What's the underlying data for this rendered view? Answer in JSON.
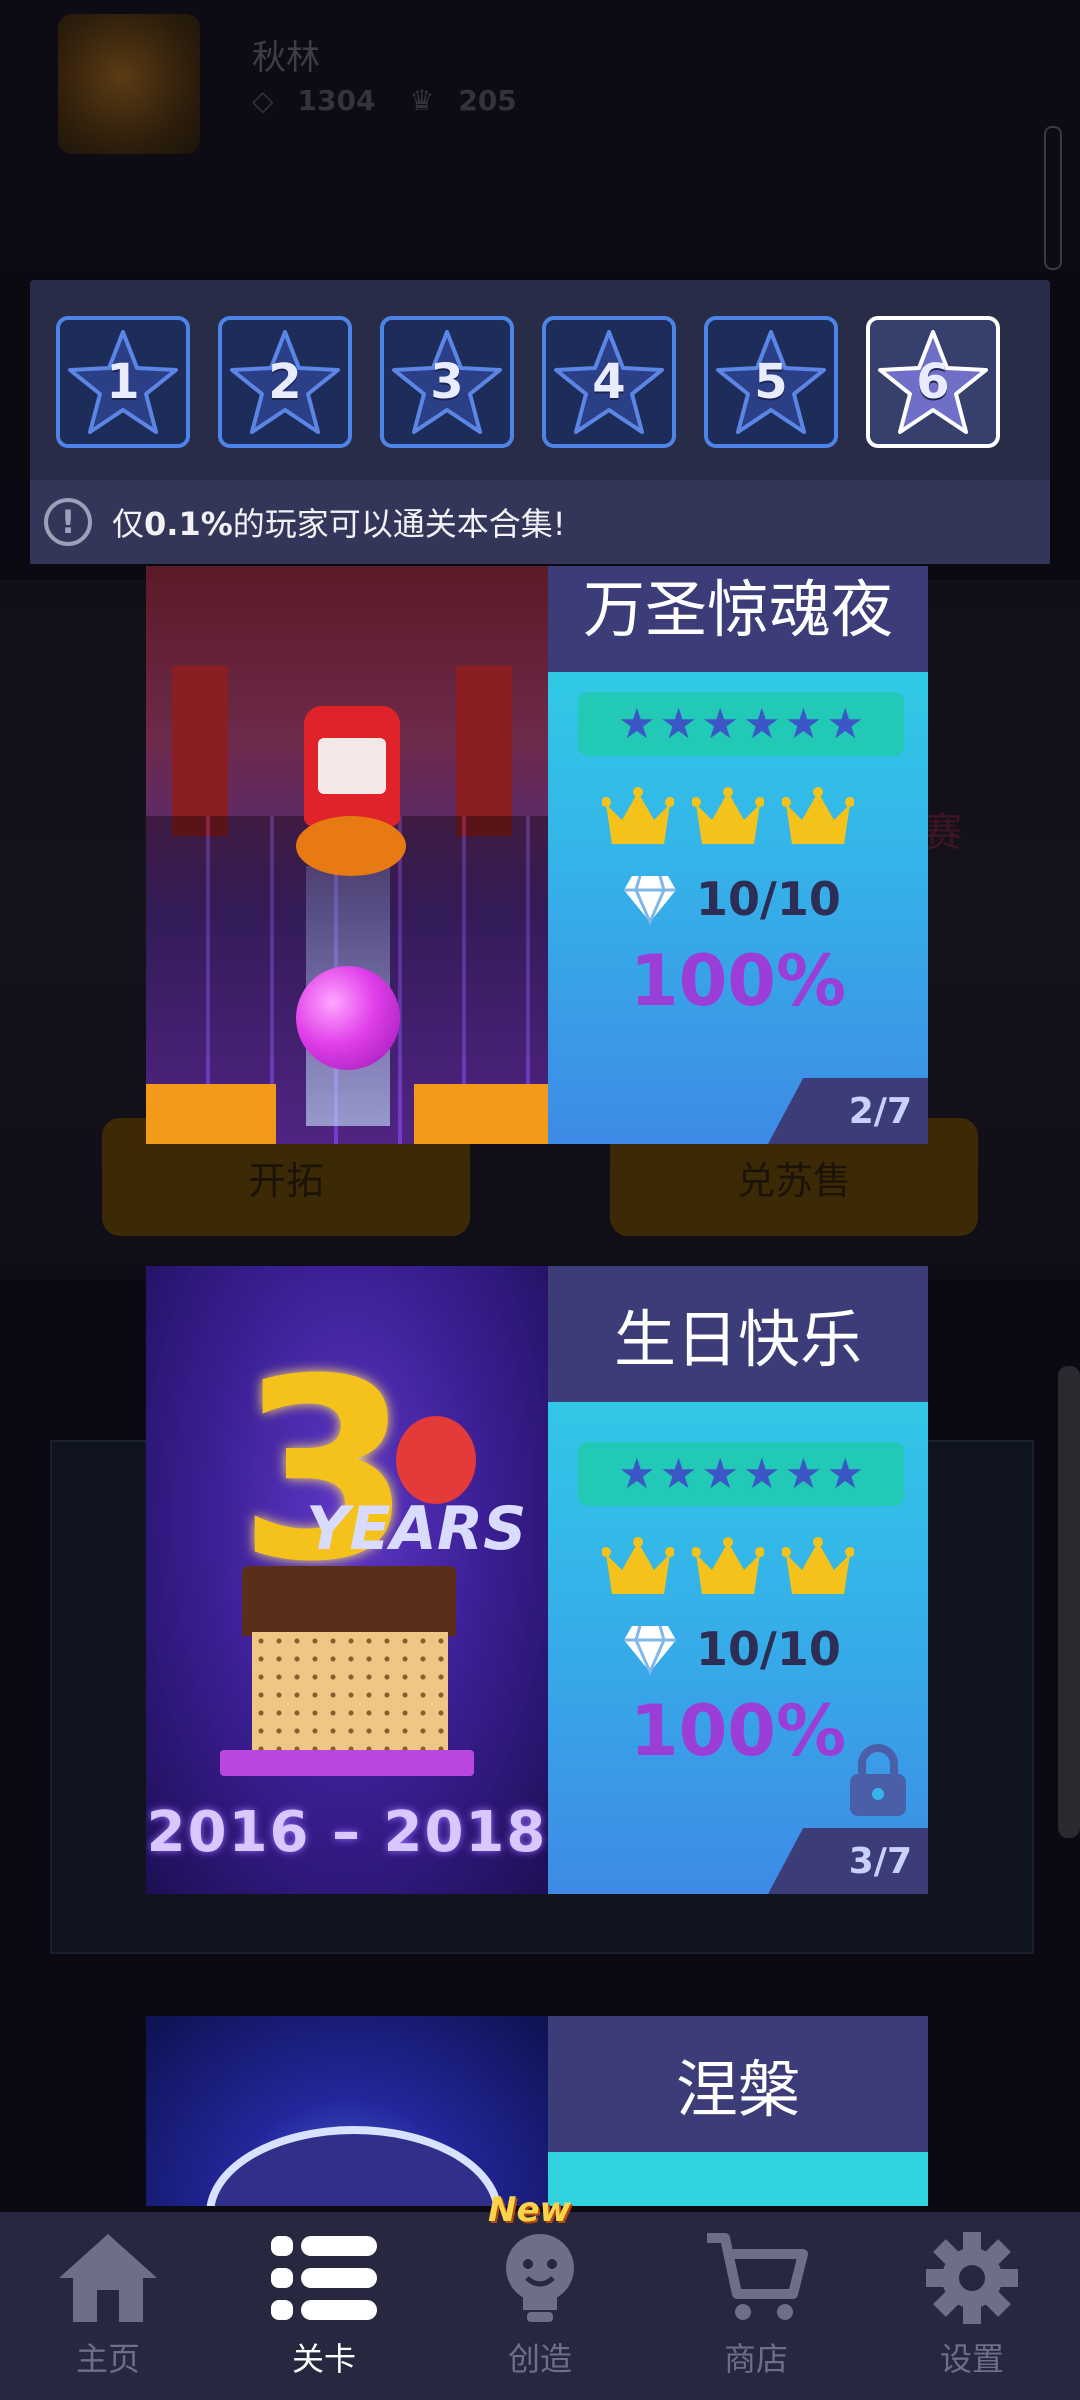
{
  "background": {
    "player_name": "秋林",
    "diamonds": "1304",
    "crowns": "205",
    "button_left": "开拓",
    "button_right": "兑苏售",
    "side_text": "赛"
  },
  "levels": {
    "tiles": [
      {
        "label": "1"
      },
      {
        "label": "2"
      },
      {
        "label": "3"
      },
      {
        "label": "4"
      },
      {
        "label": "5"
      },
      {
        "label": "6",
        "selected": true
      }
    ],
    "tip_prefix": "仅",
    "tip_percent": "0.1%",
    "tip_suffix": "的玩家可以通关本合集!"
  },
  "cards": [
    {
      "title": "万圣惊魂夜",
      "stars": 6,
      "crowns": 3,
      "gems": "10/10",
      "percent": "100%",
      "page": "2/7",
      "locked": false
    },
    {
      "title": "生日快乐",
      "stars": 6,
      "crowns": 3,
      "gems": "10/10",
      "percent": "100%",
      "page": "3/7",
      "locked": true,
      "art_text_years": "YEARS",
      "art_text_dates": "2016 – 2018"
    },
    {
      "title": "涅槃"
    }
  ],
  "nav": {
    "items": [
      {
        "label": "主页",
        "icon": "home-icon"
      },
      {
        "label": "关卡",
        "icon": "list-icon",
        "active": true
      },
      {
        "label": "创造",
        "icon": "lightbulb-icon"
      },
      {
        "label": "商店",
        "icon": "cart-icon"
      },
      {
        "label": "设置",
        "icon": "gear-icon"
      }
    ],
    "new_badge": "New"
  },
  "colors": {
    "accent_blue": "#4d84e8",
    "panel": "#292c47",
    "card_title_bg": "#3b3c78",
    "percent": "#9b3ed8",
    "crown": "#f5c21b"
  }
}
